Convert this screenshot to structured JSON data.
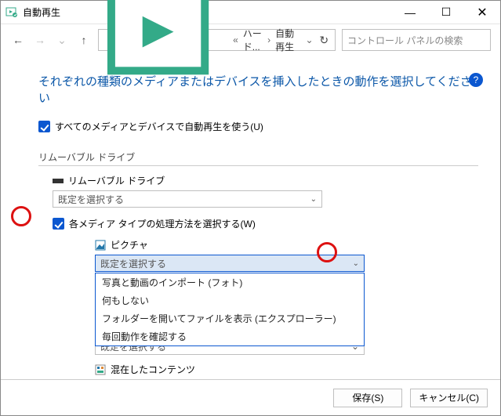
{
  "window": {
    "title": "自動再生"
  },
  "toolbar": {
    "crumb1": "ハード...",
    "crumb2": "自動再生",
    "search_placeholder": "コントロール パネルの検索"
  },
  "heading": "それぞれの種類のメディアまたはデバイスを挿入したときの動作を選択してください",
  "chk_all": "すべてのメディアとデバイスで自動再生を使う(U)",
  "section_removable": "リムーバブル ドライブ",
  "removable_label": "リムーバブル ドライブ",
  "default_choice": "既定を選択する",
  "chk_each": "各メディア タイプの処理方法を選択する(W)",
  "media": {
    "pictures": "ピクチャ",
    "mixed": "混在したコンテンツ"
  },
  "options": {
    "o1": "写真と動画のインポート (フォト)",
    "o2": "何もしない",
    "o3": "フォルダーを開いてファイルを表示 (エクスプローラー)",
    "o4": "毎回動作を確認する"
  },
  "footer": {
    "save": "保存(S)",
    "cancel": "キャンセル(C)"
  },
  "glyph": {
    "chev": "⌄",
    "rsaquo": "›",
    "larr": "←",
    "rarr": "→",
    "uarr": "↑",
    "ref": "↻",
    "min": "—",
    "max": "☐",
    "close": "✕",
    "q": "?"
  }
}
